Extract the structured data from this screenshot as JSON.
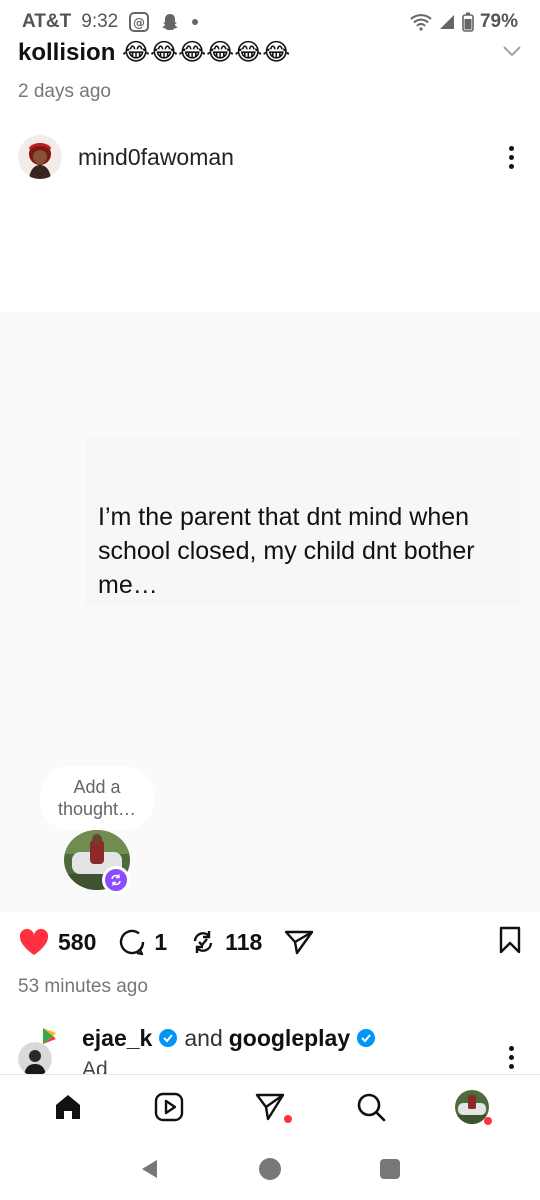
{
  "status_bar": {
    "carrier": "AT&T",
    "time": "9:32",
    "battery": "79%"
  },
  "header": {
    "title": "kollision 😂😂😂😂😂😂",
    "subtitle": "2 days ago"
  },
  "post": {
    "author": "mind0fawoman",
    "text": "I’m the parent that dnt mind when school closed, my child dnt bother me…",
    "thought_prompt": "Add a thought…",
    "likes": "580",
    "replies": "1",
    "reposts": "118",
    "time": "53 minutes ago"
  },
  "next_post": {
    "user1": "ejae_k",
    "and": "and",
    "user2": "googleplay",
    "label": "Ad"
  },
  "colors": {
    "like": "#ff3040",
    "verified": "#0095f6",
    "thought_badge": "#8a4dff",
    "notification_dot": "#ff3040"
  },
  "icons": {
    "header": "chevron-down-icon",
    "tabs": [
      "home-icon",
      "reels-icon",
      "send-icon",
      "search-icon",
      "profile-avatar"
    ],
    "system_nav": [
      "back-icon",
      "home-circle-icon",
      "recents-icon"
    ]
  }
}
